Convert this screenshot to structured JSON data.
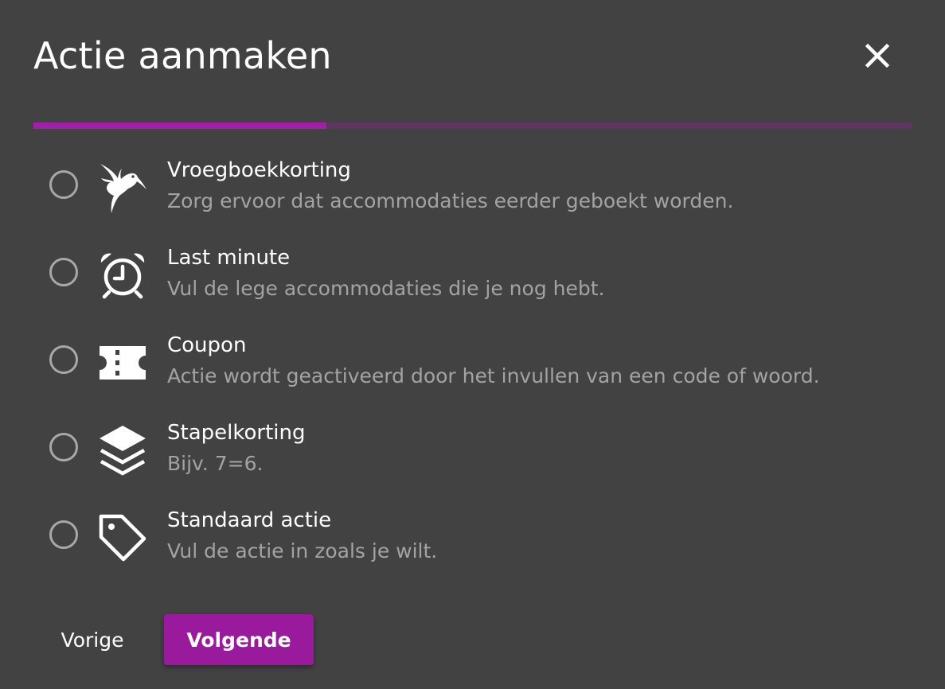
{
  "dialog": {
    "title": "Actie aanmaken",
    "progress_fraction": 0.333
  },
  "colors": {
    "background": "#424242",
    "accent": "#9a1a9e",
    "progress_track": "#5e3460",
    "progress_fill": "#a020a8",
    "secondary_text": "#a3a3a3"
  },
  "options": [
    {
      "title": "Vroegboekkorting",
      "description": "Zorg ervoor dat accommodaties eerder geboekt worden.",
      "icon": "hummingbird-icon"
    },
    {
      "title": "Last minute",
      "description": "Vul de lege accommodaties die je nog hebt.",
      "icon": "alarm-clock-icon"
    },
    {
      "title": "Coupon",
      "description": "Actie wordt geactiveerd door het invullen van een code of woord.",
      "icon": "ticket-icon"
    },
    {
      "title": "Stapelkorting",
      "description": "Bijv. 7=6.",
      "icon": "layers-icon"
    },
    {
      "title": "Standaard actie",
      "description": "Vul de actie in zoals je wilt.",
      "icon": "tag-icon"
    }
  ],
  "footer": {
    "prev_label": "Vorige",
    "next_label": "Volgende"
  }
}
